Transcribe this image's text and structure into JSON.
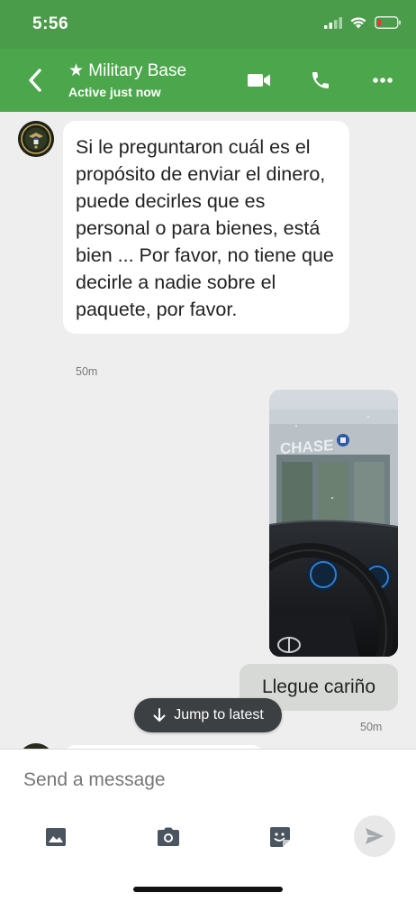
{
  "status_bar": {
    "time": "5:56",
    "icons": [
      "signal-icon",
      "wifi-icon",
      "battery-low-icon"
    ],
    "battery_color": "#e53935"
  },
  "header": {
    "back_icon": "chevron-left-icon",
    "title": "★ Military Base",
    "subtitle": "Active just now",
    "actions": [
      "video-call-icon",
      "phone-icon",
      "more-icon"
    ],
    "color": "#4ca64c"
  },
  "messages": [
    {
      "direction": "incoming",
      "avatar": "army-seal-avatar",
      "text": "Si le preguntaron cuál es el propósito de enviar el dinero, puede decirles que es personal o para bienes, está bien ... Por favor, no tiene que decirle a nadie sobre el paquete, por favor.",
      "time": "50m"
    },
    {
      "direction": "outgoing",
      "type": "photo",
      "photo_sign_text": "CHASE"
    },
    {
      "direction": "outgoing",
      "text": "Llegue cariño",
      "time": "50m"
    }
  ],
  "jump_to_latest": {
    "label": "Jump to latest",
    "icon": "arrow-down-icon"
  },
  "composer": {
    "placeholder": "Send a message",
    "tools": [
      "image-icon",
      "camera-icon",
      "sticker-icon"
    ],
    "send_icon": "send-icon"
  }
}
